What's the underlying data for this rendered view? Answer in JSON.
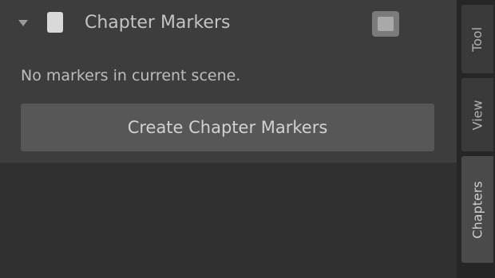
{
  "panel": {
    "title": "Chapter Markers",
    "message": "No markers in current scene.",
    "button_label": "Create Chapter Markers"
  },
  "side_tabs": [
    {
      "label": "Tool"
    },
    {
      "label": "View"
    },
    {
      "label": "Chapters"
    }
  ],
  "icons": {
    "collapse": "chevron-down-icon",
    "panel": "chapter-marker-icon",
    "settings": "panel-settings-icon"
  }
}
